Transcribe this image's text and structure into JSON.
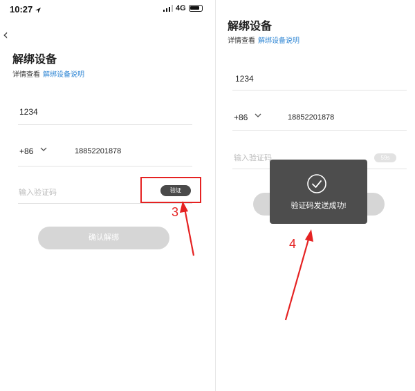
{
  "status_bar": {
    "time": "10:27",
    "network": "4G"
  },
  "screen_left": {
    "title": "解绑设备",
    "detail_prefix": "详情查看",
    "detail_link": "解绑设备说明",
    "device_code": "1234",
    "country_code": "+86",
    "phone_number": "18852201878",
    "code_placeholder": "输入验证码",
    "verify_button": "验证",
    "confirm_button": "确认解绑",
    "step_label": "3"
  },
  "screen_right": {
    "title": "解绑设备",
    "detail_prefix": "详情查看",
    "detail_link": "解绑设备说明",
    "device_code": "1234",
    "country_code": "+86",
    "phone_number": "18852201878",
    "code_placeholder": "输入验证码",
    "countdown": "59s",
    "toast_message": "验证码发送成功!",
    "step_label": "4"
  },
  "colors": {
    "annotation": "#e52222",
    "link": "#2f86d4",
    "toast_bg": "#4d4d4d"
  }
}
